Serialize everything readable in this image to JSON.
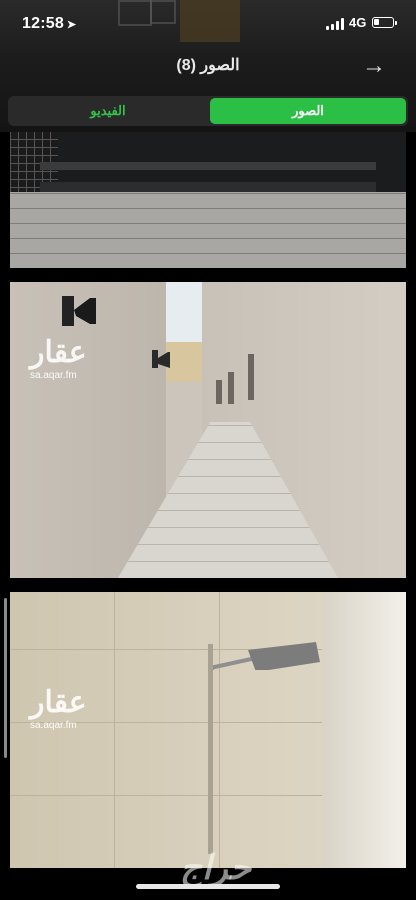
{
  "status_bar": {
    "time": "12:58",
    "location_arrow": "➤",
    "network": "4G",
    "signal_bars": 4,
    "battery_level": 0.3
  },
  "header": {
    "title": "الصور (8)",
    "back_icon": "→"
  },
  "tabs": [
    {
      "label": "الفيديو",
      "active": false
    },
    {
      "label": "الصور",
      "active": true
    }
  ],
  "accent_color": "#2bbf45",
  "watermarks": [
    {
      "ar": "عقار",
      "url": "sa.aqar.fm"
    },
    {
      "ar": "عقار",
      "url": "sa.aqar.fm"
    }
  ],
  "bottom_logo": "حراج"
}
